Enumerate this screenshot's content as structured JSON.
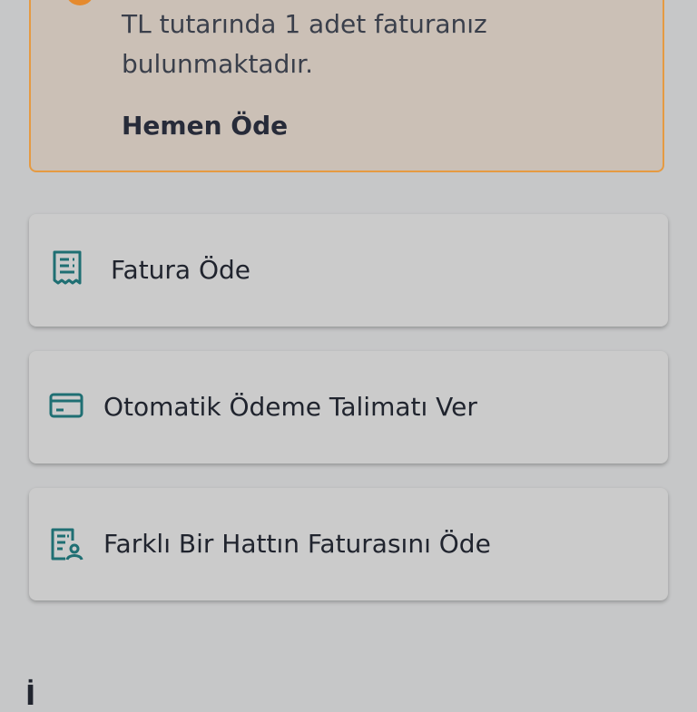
{
  "notice": {
    "text_line_1": "TL tutarında 1 adet faturanız",
    "text_line_2": "bulunmaktadır.",
    "action_label": "Hemen Öde",
    "accent_color": "#e59a42"
  },
  "actions": [
    {
      "label": "Fatura Öde",
      "icon": "receipt-icon"
    },
    {
      "label": "Otomatik Ödeme Talimatı Ver",
      "icon": "credit-card-icon"
    },
    {
      "label": "Farklı Bir Hattın Faturasını Öde",
      "icon": "bill-user-icon"
    }
  ],
  "theme": {
    "icon_color": "#1f6f73",
    "background": "#c6c7c8"
  },
  "section_peek": "İ"
}
